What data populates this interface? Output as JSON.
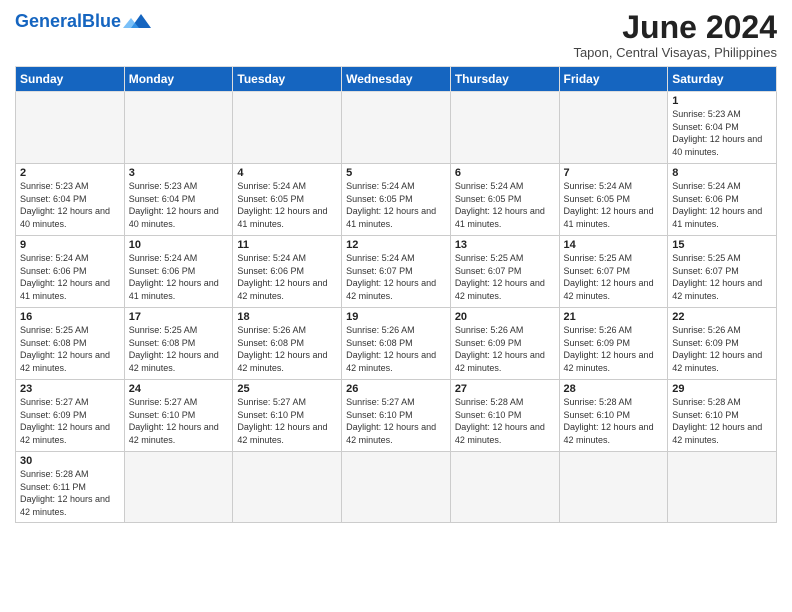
{
  "header": {
    "logo_general": "General",
    "logo_blue": "Blue",
    "month_title": "June 2024",
    "subtitle": "Tapon, Central Visayas, Philippines"
  },
  "days_of_week": [
    "Sunday",
    "Monday",
    "Tuesday",
    "Wednesday",
    "Thursday",
    "Friday",
    "Saturday"
  ],
  "weeks": [
    [
      {
        "day": "",
        "info": "",
        "empty": true
      },
      {
        "day": "",
        "info": "",
        "empty": true
      },
      {
        "day": "",
        "info": "",
        "empty": true
      },
      {
        "day": "",
        "info": "",
        "empty": true
      },
      {
        "day": "",
        "info": "",
        "empty": true
      },
      {
        "day": "",
        "info": "",
        "empty": true
      },
      {
        "day": "1",
        "info": "Sunrise: 5:23 AM\nSunset: 6:04 PM\nDaylight: 12 hours and 40 minutes."
      }
    ],
    [
      {
        "day": "2",
        "info": "Sunrise: 5:23 AM\nSunset: 6:04 PM\nDaylight: 12 hours and 40 minutes."
      },
      {
        "day": "3",
        "info": "Sunrise: 5:23 AM\nSunset: 6:04 PM\nDaylight: 12 hours and 40 minutes."
      },
      {
        "day": "4",
        "info": "Sunrise: 5:24 AM\nSunset: 6:05 PM\nDaylight: 12 hours and 41 minutes."
      },
      {
        "day": "5",
        "info": "Sunrise: 5:24 AM\nSunset: 6:05 PM\nDaylight: 12 hours and 41 minutes."
      },
      {
        "day": "6",
        "info": "Sunrise: 5:24 AM\nSunset: 6:05 PM\nDaylight: 12 hours and 41 minutes."
      },
      {
        "day": "7",
        "info": "Sunrise: 5:24 AM\nSunset: 6:05 PM\nDaylight: 12 hours and 41 minutes."
      },
      {
        "day": "8",
        "info": "Sunrise: 5:24 AM\nSunset: 6:06 PM\nDaylight: 12 hours and 41 minutes."
      }
    ],
    [
      {
        "day": "9",
        "info": "Sunrise: 5:24 AM\nSunset: 6:06 PM\nDaylight: 12 hours and 41 minutes."
      },
      {
        "day": "10",
        "info": "Sunrise: 5:24 AM\nSunset: 6:06 PM\nDaylight: 12 hours and 41 minutes."
      },
      {
        "day": "11",
        "info": "Sunrise: 5:24 AM\nSunset: 6:06 PM\nDaylight: 12 hours and 42 minutes."
      },
      {
        "day": "12",
        "info": "Sunrise: 5:24 AM\nSunset: 6:07 PM\nDaylight: 12 hours and 42 minutes."
      },
      {
        "day": "13",
        "info": "Sunrise: 5:25 AM\nSunset: 6:07 PM\nDaylight: 12 hours and 42 minutes."
      },
      {
        "day": "14",
        "info": "Sunrise: 5:25 AM\nSunset: 6:07 PM\nDaylight: 12 hours and 42 minutes."
      },
      {
        "day": "15",
        "info": "Sunrise: 5:25 AM\nSunset: 6:07 PM\nDaylight: 12 hours and 42 minutes."
      }
    ],
    [
      {
        "day": "16",
        "info": "Sunrise: 5:25 AM\nSunset: 6:08 PM\nDaylight: 12 hours and 42 minutes."
      },
      {
        "day": "17",
        "info": "Sunrise: 5:25 AM\nSunset: 6:08 PM\nDaylight: 12 hours and 42 minutes."
      },
      {
        "day": "18",
        "info": "Sunrise: 5:26 AM\nSunset: 6:08 PM\nDaylight: 12 hours and 42 minutes."
      },
      {
        "day": "19",
        "info": "Sunrise: 5:26 AM\nSunset: 6:08 PM\nDaylight: 12 hours and 42 minutes."
      },
      {
        "day": "20",
        "info": "Sunrise: 5:26 AM\nSunset: 6:09 PM\nDaylight: 12 hours and 42 minutes."
      },
      {
        "day": "21",
        "info": "Sunrise: 5:26 AM\nSunset: 6:09 PM\nDaylight: 12 hours and 42 minutes."
      },
      {
        "day": "22",
        "info": "Sunrise: 5:26 AM\nSunset: 6:09 PM\nDaylight: 12 hours and 42 minutes."
      }
    ],
    [
      {
        "day": "23",
        "info": "Sunrise: 5:27 AM\nSunset: 6:09 PM\nDaylight: 12 hours and 42 minutes."
      },
      {
        "day": "24",
        "info": "Sunrise: 5:27 AM\nSunset: 6:10 PM\nDaylight: 12 hours and 42 minutes."
      },
      {
        "day": "25",
        "info": "Sunrise: 5:27 AM\nSunset: 6:10 PM\nDaylight: 12 hours and 42 minutes."
      },
      {
        "day": "26",
        "info": "Sunrise: 5:27 AM\nSunset: 6:10 PM\nDaylight: 12 hours and 42 minutes."
      },
      {
        "day": "27",
        "info": "Sunrise: 5:28 AM\nSunset: 6:10 PM\nDaylight: 12 hours and 42 minutes."
      },
      {
        "day": "28",
        "info": "Sunrise: 5:28 AM\nSunset: 6:10 PM\nDaylight: 12 hours and 42 minutes."
      },
      {
        "day": "29",
        "info": "Sunrise: 5:28 AM\nSunset: 6:10 PM\nDaylight: 12 hours and 42 minutes."
      }
    ],
    [
      {
        "day": "30",
        "info": "Sunrise: 5:28 AM\nSunset: 6:11 PM\nDaylight: 12 hours and 42 minutes."
      },
      {
        "day": "",
        "info": "",
        "empty": true
      },
      {
        "day": "",
        "info": "",
        "empty": true
      },
      {
        "day": "",
        "info": "",
        "empty": true
      },
      {
        "day": "",
        "info": "",
        "empty": true
      },
      {
        "day": "",
        "info": "",
        "empty": true
      },
      {
        "day": "",
        "info": "",
        "empty": true
      }
    ]
  ]
}
